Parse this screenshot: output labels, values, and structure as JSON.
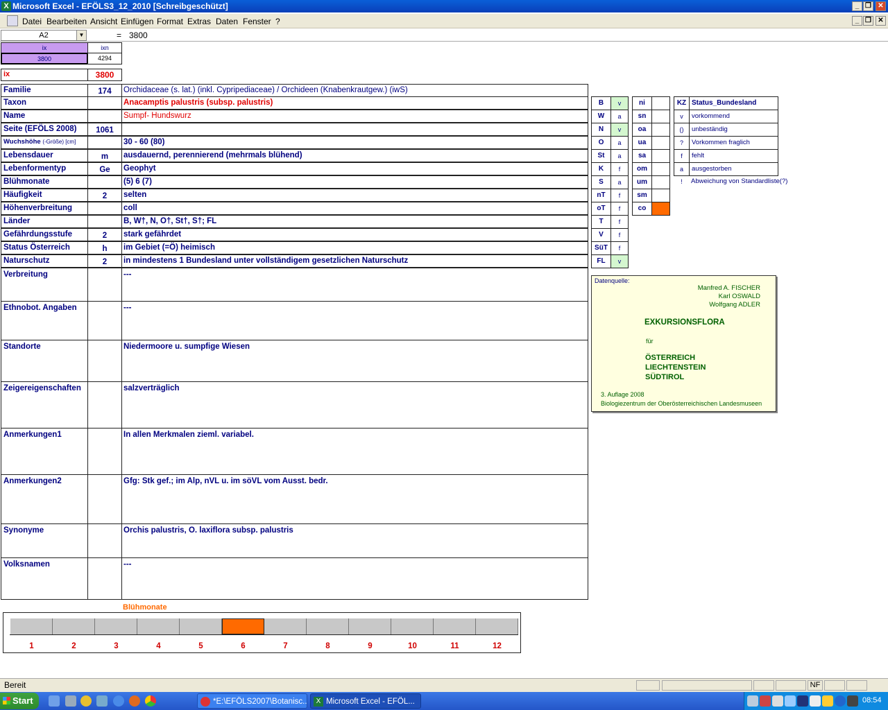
{
  "window": {
    "title": "Microsoft Excel - EFÖLS3_12_2010  [Schreibgeschützt]"
  },
  "menu": [
    "Datei",
    "Bearbeiten",
    "Ansicht",
    "Einfügen",
    "Format",
    "Extras",
    "Daten",
    "Fenster",
    "?"
  ],
  "formula": {
    "cell_ref": "A2",
    "eq": "=",
    "value": "3800"
  },
  "index": {
    "ix_label": "ix",
    "ixn_label": "ixn",
    "ix_value": "3800",
    "ixn_value": "4294",
    "ix_big_label": "ix",
    "ix_big_value": "3800"
  },
  "rows": [
    {
      "label": "Familie",
      "num": "174",
      "value": "Orchidaceae (s. lat.) (inkl. Cypripediaceae)  /  Orchideen (Knabenkrautgew.) (iwS)"
    },
    {
      "label": "Taxon",
      "num": "",
      "value": "Anacamptis palustris (subsp. palustris)"
    },
    {
      "label": "Name",
      "num": "",
      "value": "Sumpf- Hundswurz"
    },
    {
      "label": "Seite (EFÖLS 2008)",
      "num": "1061",
      "value": ""
    },
    {
      "label": "Wuchshöhe",
      "label_small": "(-Größe) [cm]",
      "num": "",
      "value": "30 - 60 (80)"
    },
    {
      "label": "Lebensdauer",
      "num": "m",
      "value": "ausdauernd, perennierend (mehrmals blühend)"
    },
    {
      "label": "Lebenformentyp",
      "num": "Ge",
      "value": "Geophyt"
    },
    {
      "label": "Blühmonate",
      "num": "",
      "value": "(5) 6 (7)"
    },
    {
      "label": "Häufigkeit",
      "num": "2",
      "value": "selten"
    },
    {
      "label": "Höhenverbreitung",
      "num": "",
      "value": "coll"
    },
    {
      "label": "Länder",
      "num": "",
      "value": "B, W†, N, O†, St†, S†; FL"
    },
    {
      "label": "Gefährdungsstufe",
      "num": "2",
      "value": "stark gefährdet"
    },
    {
      "label": "Status Österreich",
      "num": "h",
      "value": "im Gebiet (=Ö) heimisch"
    },
    {
      "label": "Naturschutz",
      "num": "2",
      "value": "in mindestens 1 Bundesland unter vollständigem gesetzlichen Naturschutz"
    }
  ],
  "blocks": [
    {
      "label": "Verbreitung",
      "value": "---"
    },
    {
      "label": "Ethnobot. Angaben",
      "value": "---"
    },
    {
      "label": "Standorte",
      "value": "Niedermoore u. sumpfige Wiesen"
    },
    {
      "label": "Zeigereigenschaften",
      "value": "salzverträglich"
    },
    {
      "label": "Anmerkungen1",
      "value": "In allen Merkmalen zieml. variabel."
    },
    {
      "label": "Anmerkungen2",
      "value": "Gfg: Stk gef.; im Alp, nVL u. im söVL vom Ausst. bedr."
    },
    {
      "label": "Synonyme",
      "value": "Orchis palustris, O. laxiflora subsp. palustris"
    },
    {
      "label": "Volksnamen",
      "value": "---"
    }
  ],
  "states": [
    {
      "code": "B",
      "val": "v"
    },
    {
      "code": "W",
      "val": "a"
    },
    {
      "code": "N",
      "val": "v"
    },
    {
      "code": "O",
      "val": "a"
    },
    {
      "code": "St",
      "val": "a"
    },
    {
      "code": "K",
      "val": "f"
    },
    {
      "code": "S",
      "val": "a"
    },
    {
      "code": "nT",
      "val": "f"
    },
    {
      "code": "oT",
      "val": "f"
    },
    {
      "code": "T",
      "val": "f"
    },
    {
      "code": "V",
      "val": "f"
    },
    {
      "code": "SüT",
      "val": "f"
    },
    {
      "code": "FL",
      "val": "v"
    }
  ],
  "zones": [
    {
      "code": "ni",
      "val": ""
    },
    {
      "code": "sn",
      "val": ""
    },
    {
      "code": "oa",
      "val": ""
    },
    {
      "code": "ua",
      "val": ""
    },
    {
      "code": "sa",
      "val": ""
    },
    {
      "code": "om",
      "val": ""
    },
    {
      "code": "um",
      "val": ""
    },
    {
      "code": "sm",
      "val": ""
    },
    {
      "code": "co",
      "val": "c"
    }
  ],
  "legend": {
    "kz": "KZ",
    "title": "Status_Bundesland",
    "items": [
      {
        "k": "v",
        "t": "vorkommend"
      },
      {
        "k": "()",
        "t": "unbeständig"
      },
      {
        "k": "?",
        "t": "Vorkommen fraglich"
      },
      {
        "k": "f",
        "t": "fehlt"
      },
      {
        "k": "a",
        "t": "ausgestorben"
      },
      {
        "k": "!",
        "t": "Abweichung von Standardliste(?)"
      }
    ]
  },
  "source": {
    "label": "Datenquelle:",
    "authors": [
      "Manfred A. FISCHER",
      "Karl OSWALD",
      "Wolfgang ADLER"
    ],
    "book": "EXKURSIONSFLORA",
    "fuer": "für",
    "regions": [
      "ÖSTERREICH",
      "LIECHTENSTEIN",
      "SÜDTIROL"
    ],
    "edition": "3. Auflage 2008",
    "publisher": "Biologiezentrum der Oberösterreichischen Landesmuseen"
  },
  "months": {
    "title": "Blühmonate",
    "labels": [
      "1",
      "2",
      "3",
      "4",
      "5",
      "6",
      "7",
      "8",
      "9",
      "10",
      "11",
      "12"
    ],
    "highlight": 6
  },
  "status": {
    "ready": "Bereit",
    "nf": "NF"
  },
  "taskbar": {
    "start": "Start",
    "tasks": [
      "*E:\\EFÖLS2007\\Botanisc...",
      "Microsoft Excel - EFÖL..."
    ],
    "clock": "08:54"
  },
  "colors": {
    "accent": "#ff6a00",
    "lilac": "#c89bf0",
    "green_cell": "#d4f7cf",
    "text_blue": "#000080",
    "red": "#e00000"
  }
}
